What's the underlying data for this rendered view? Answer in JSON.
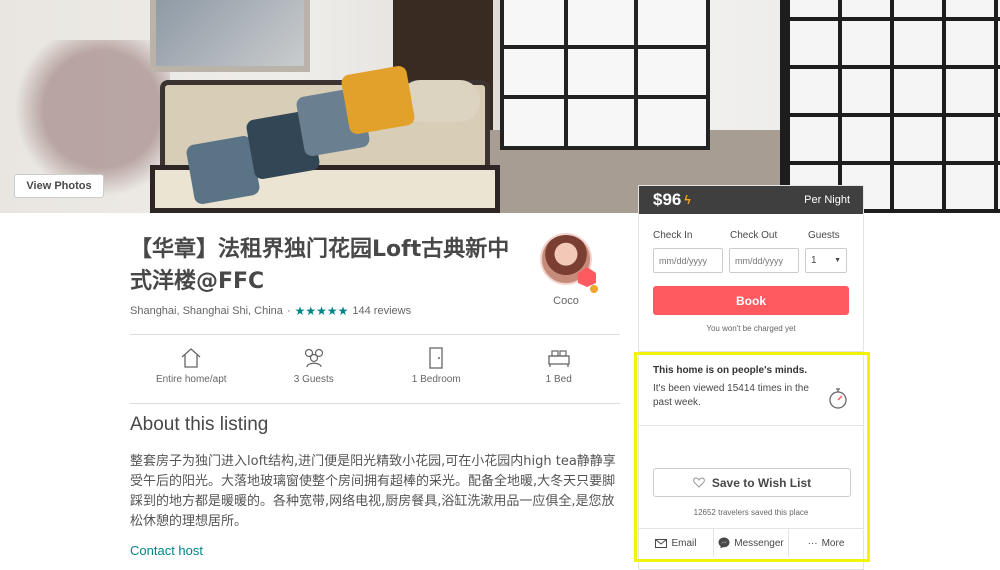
{
  "hero": {
    "view_photos_label": "View Photos"
  },
  "listing": {
    "title": "【华章】法租界独门花园Loft古典新中式洋楼@FFC",
    "location": "Shanghai, Shanghai Shi, China",
    "stars": "★★★★★",
    "reviews": "144 reviews",
    "rating": 5
  },
  "host": {
    "name": "Coco"
  },
  "amenities": [
    {
      "icon": "home-icon",
      "label": "Entire home/apt"
    },
    {
      "icon": "guests-icon",
      "label": "3 Guests"
    },
    {
      "icon": "door-icon",
      "label": "1 Bedroom"
    },
    {
      "icon": "bed-icon",
      "label": "1 Bed"
    }
  ],
  "about": {
    "heading": "About this listing",
    "description": "整套房子为独门进入loft结构,进门便是阳光精致小花园,可在小花园内high tea静静享受午后的阳光。大落地玻璃窗使整个房间拥有超棒的采光。配备全地暖,大冬天只要脚踩到的地方都是暖暖的。各种宽带,网络电视,厨房餐具,浴缸洗漱用品一应俱全,是您放松休憩的理想居所。",
    "contact_label": "Contact host"
  },
  "booking": {
    "price": "$96",
    "per_night": "Per Night",
    "check_in_label": "Check In",
    "check_out_label": "Check Out",
    "guests_label": "Guests",
    "check_in_placeholder": "mm/dd/yyyy",
    "check_out_placeholder": "mm/dd/yyyy",
    "guests_value": "1",
    "book_label": "Book",
    "charged_note": "You won't be charged yet"
  },
  "minds": {
    "title": "This home is on people's minds.",
    "text": "It's been viewed 15414 times in the past week."
  },
  "wishlist": {
    "label": "Save to Wish List",
    "saved_note": "12652 travelers saved this place"
  },
  "share": [
    {
      "icon": "email-icon",
      "label": "Email"
    },
    {
      "icon": "messenger-icon",
      "label": "Messenger"
    },
    {
      "icon": "more-icon",
      "label": "More"
    }
  ],
  "colors": {
    "accent": "#ff5a5f",
    "link": "#008489",
    "price_bar": "#3f3f3f",
    "highlight": "#f3f20b"
  }
}
